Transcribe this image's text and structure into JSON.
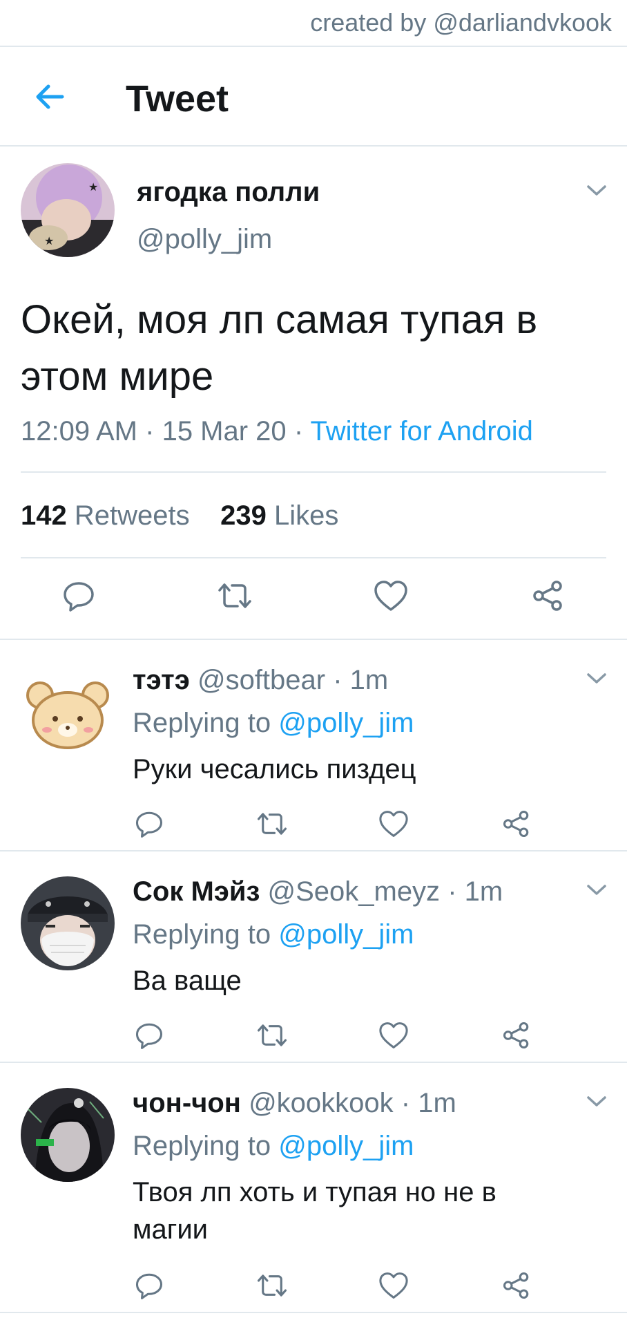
{
  "credit": {
    "text": "created by @darliandvkook"
  },
  "header": {
    "title": "Tweet"
  },
  "main_tweet": {
    "name": "ягодка полли",
    "handle": "@polly_jim",
    "text": "Окей, моя лп самая тупая в этом мире",
    "time": "12:09 AM",
    "date": "15 Mar 20",
    "source": "Twitter for Android",
    "retweets_count": "142",
    "retweets_label": "Retweets",
    "likes_count": "239",
    "likes_label": "Likes"
  },
  "replies": [
    {
      "name": "тэтэ",
      "handle": "@softbear",
      "time": "1m",
      "replying_prefix": "Replying to",
      "replying_to": "@polly_jim",
      "text": "Руки чесались пиздец"
    },
    {
      "name": "Сок Мэйз",
      "handle": "@Seok_meyz",
      "time": "1m",
      "replying_prefix": "Replying to",
      "replying_to": "@polly_jim",
      "text": "Ва ваще"
    },
    {
      "name": "чон-чон",
      "handle": "@kookkook",
      "time": "1m",
      "replying_prefix": "Replying to",
      "replying_to": "@polly_jim",
      "text": "Твоя лп хоть и тупая но не в магии"
    }
  ],
  "colors": {
    "accent": "#1da1f2",
    "secondary_text": "#657786",
    "primary_text": "#14171a",
    "divider": "#e1e8ed"
  },
  "icons": [
    "back-arrow-icon",
    "chevron-down-icon",
    "reply-icon",
    "retweet-icon",
    "like-icon",
    "share-icon"
  ]
}
